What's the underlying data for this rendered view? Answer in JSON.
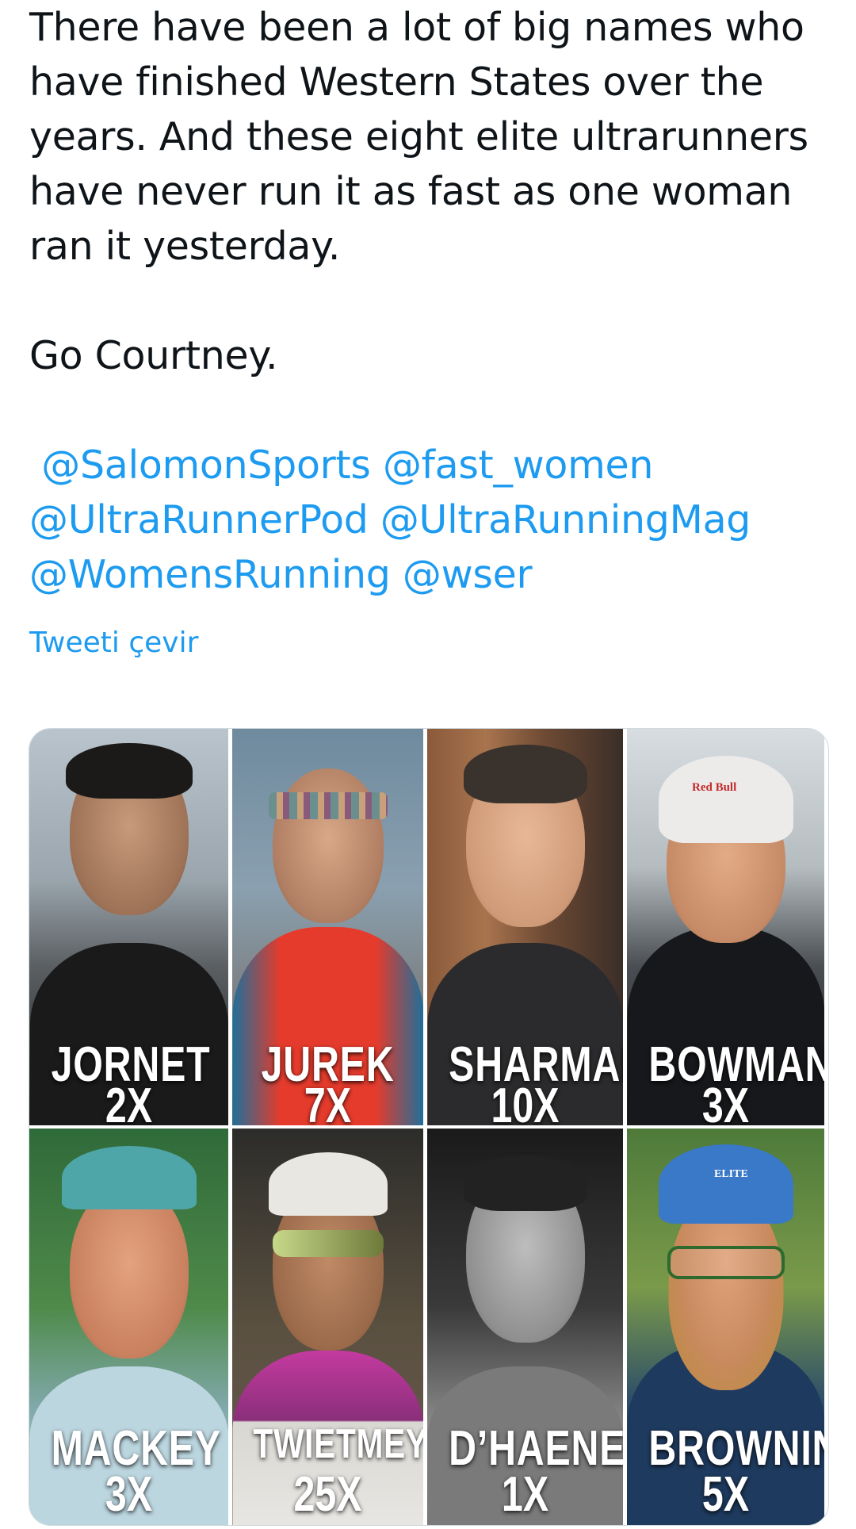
{
  "tweet": {
    "text_lines": [
      "There have been a lot of big names who",
      "have finished Western States over the",
      "years. And these eight elite ultrarunners",
      "have never run it as fast as one woman",
      "ran it yesterday."
    ],
    "closing": "Go Courtney.",
    "mentions_line1": [
      "@SalomonSports",
      "@fast_women"
    ],
    "mentions_line2": [
      "@UltraRunnerPod",
      "@UltraRunningMag"
    ],
    "mentions_line3": [
      "@WomensRunning",
      "@wser"
    ],
    "translate_label": "Tweeti çevir"
  },
  "media": {
    "runners": [
      {
        "name": "JORNET",
        "count": "2X"
      },
      {
        "name": "JUREK",
        "count": "7X"
      },
      {
        "name": "SHARMAN",
        "count": "10X"
      },
      {
        "name": "BOWMAN",
        "count": "3X"
      },
      {
        "name": "MACKEY",
        "count": "3X"
      },
      {
        "name": "TWIETMEYER",
        "count": "25X"
      },
      {
        "name": "D’HAENE",
        "count": "1X"
      },
      {
        "name": "BROWNING",
        "count": "5X"
      }
    ],
    "logos": {
      "red_bull": "Red Bull",
      "elite": "ELITE"
    }
  }
}
